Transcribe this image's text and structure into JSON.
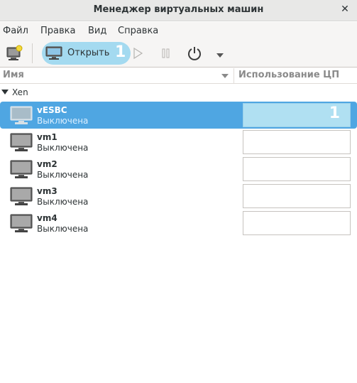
{
  "window": {
    "title": "Менеджер виртуальных машин"
  },
  "menu": {
    "items": [
      "Файл",
      "Правка",
      "Вид",
      "Справка"
    ]
  },
  "toolbar": {
    "open_label": "Открыть",
    "open_badge": "1"
  },
  "columns": {
    "name": "Имя",
    "cpu": "Использование ЦП"
  },
  "group": {
    "label": "Xen"
  },
  "vms": [
    {
      "name": "vESBC",
      "status": "Выключена",
      "selected": true,
      "badge": "1"
    },
    {
      "name": "vm1",
      "status": "Выключена",
      "selected": false
    },
    {
      "name": "vm2",
      "status": "Выключена",
      "selected": false
    },
    {
      "name": "vm3",
      "status": "Выключена",
      "selected": false
    },
    {
      "name": "vm4",
      "status": "Выключена",
      "selected": false
    }
  ],
  "colors": {
    "selection": "#4fa6e2",
    "highlight": "#a4daf0"
  }
}
